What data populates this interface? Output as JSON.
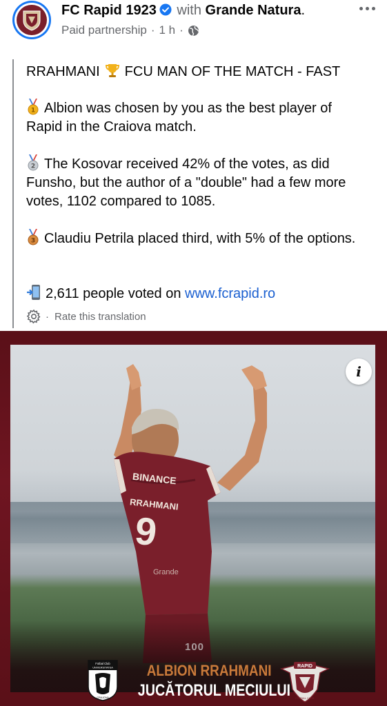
{
  "post_header": {
    "page_name": "FC Rapid 1923",
    "with_word": "with",
    "partner_name": "Grande Natura",
    "partner_suffix": ".",
    "subtitle_type": "Paid partnership",
    "subtitle_sep": "·",
    "subtitle_time": "1 h",
    "subtitle_sep2": "·",
    "audience_icon": "globe-icon",
    "more_icon": "more-options-icon"
  },
  "post_body": {
    "line1_a": "RRAHMANI",
    "line1_b": "FCU MAN OF THE MATCH - FAST",
    "para2": "Albion was chosen by you as the best player of Rapid in the Craiova match.",
    "para3": "The Kosovar received 42% of the votes, as did Funsho, but the author of a \"double\" had a few more votes, 1102 compared to 1085.",
    "para4": "Claudiu Petrila placed third, with 5% of the options.",
    "para5_text": "2,611 people voted on",
    "para5_link": "www.fcrapid.ro",
    "translate_dot": "·",
    "translate_label": "Rate this translation"
  },
  "image": {
    "info_label": "i",
    "jersey_sponsor": "BINANCE",
    "jersey_name": "RRAHMANI",
    "jersey_number": "9",
    "jersey_brand": "Grande",
    "badge_100": "100",
    "player_name": "ALBION RRAHMANI",
    "caption_title": "JUCĂTORUL MECIULUI",
    "crest_left_text_top": "Fotbal Club",
    "crest_left_text_bottom": "UNIVERSITATEA",
    "crest_left_text_city": "CRAIOVA",
    "crest_right_text": "RAPID",
    "crest_right_subtext": "FOTBAL CLUB"
  },
  "colors": {
    "verified": "#1877f2",
    "link": "#1a5fd0",
    "muted": "#65676b",
    "club_maroon": "#7a1f2b",
    "name_accent": "#c97a3a"
  },
  "icons": {
    "trophy": "trophy-icon",
    "gold_medal": "gold-medal-icon",
    "silver_medal": "silver-medal-icon",
    "bronze_medal": "bronze-medal-icon",
    "phone": "mobile-phone-arrow-icon",
    "gear": "gear-icon",
    "verified": "verified-badge-icon"
  }
}
